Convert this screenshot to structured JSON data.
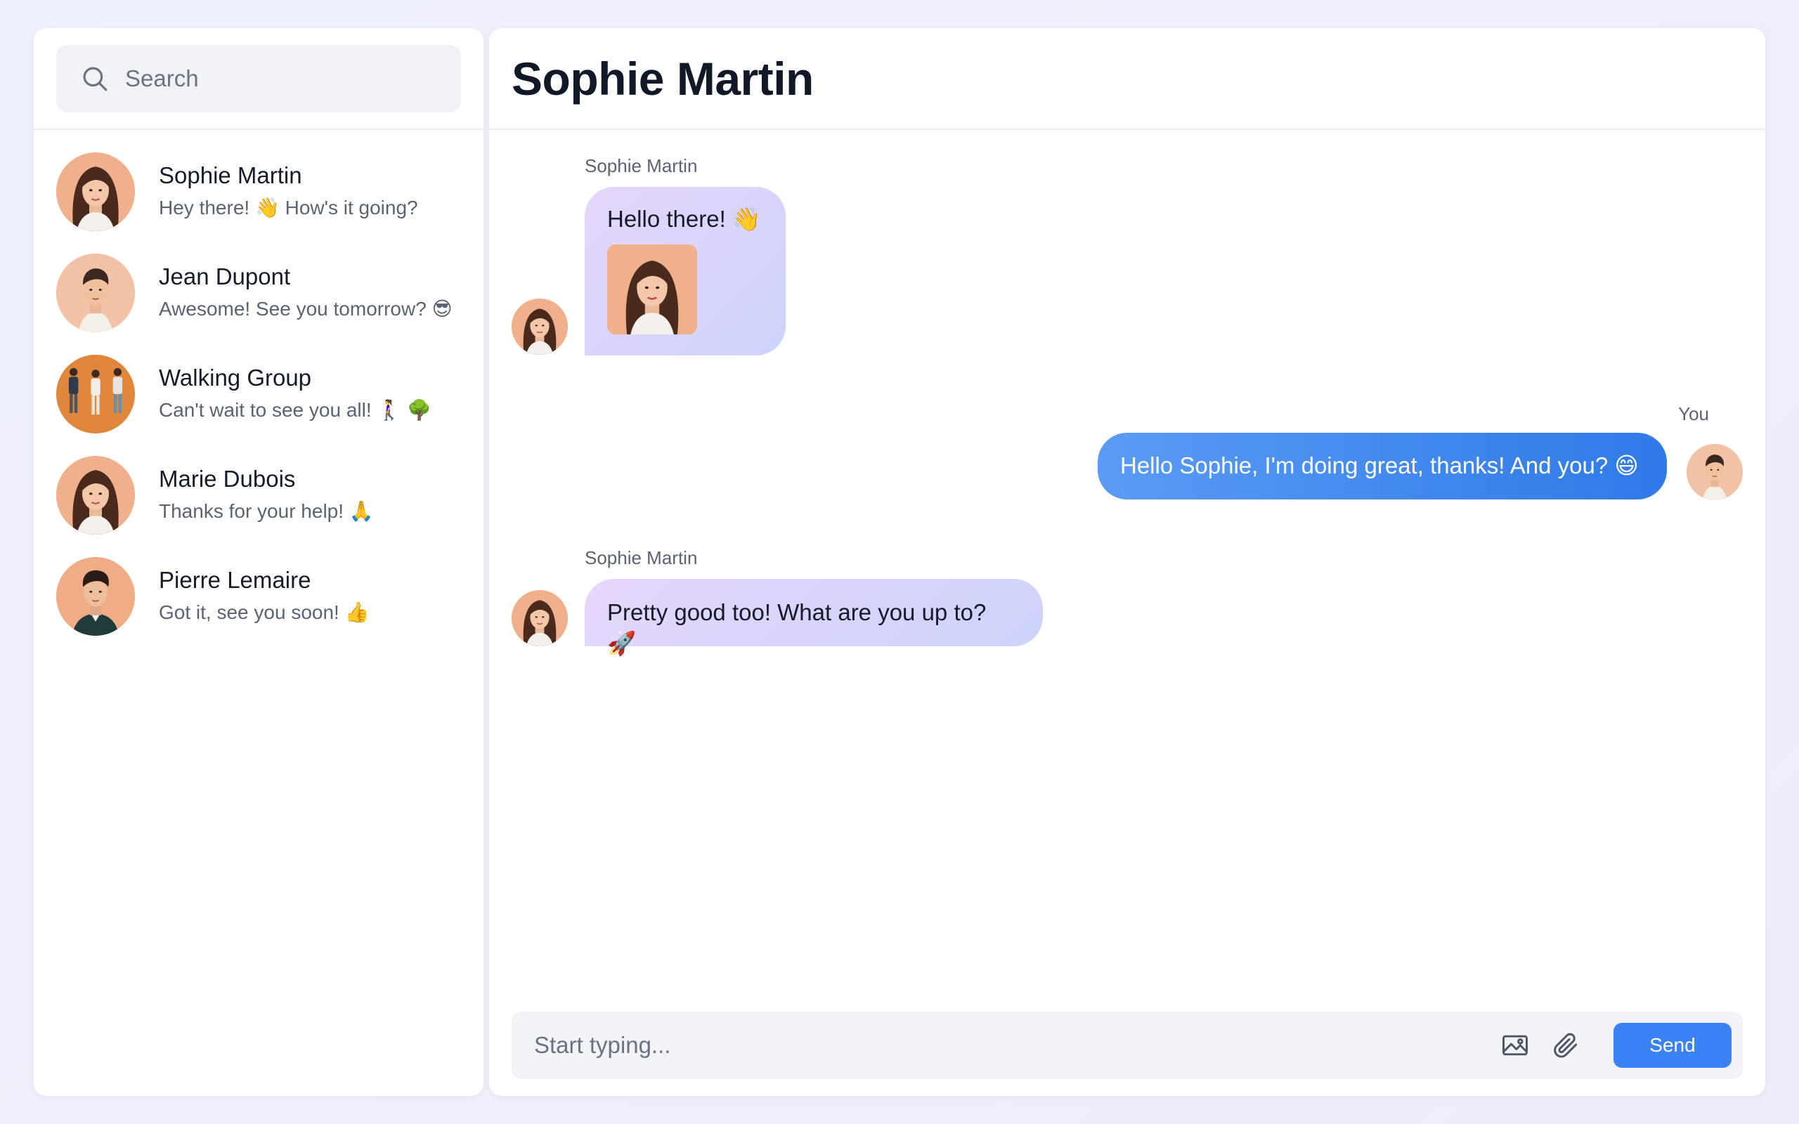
{
  "search": {
    "placeholder": "Search"
  },
  "contacts": [
    {
      "name": "Sophie Martin",
      "preview": "Hey there! 👋 How's it going?",
      "avatar": "woman-long-hair"
    },
    {
      "name": "Jean Dupont",
      "preview": "Awesome! See you tomorrow? 😎",
      "avatar": "man-short-hair"
    },
    {
      "name": "Walking Group",
      "preview": "Can't wait to see you all! 🚶‍♀️ 🌳",
      "avatar": "group-people"
    },
    {
      "name": "Marie Dubois",
      "preview": "Thanks for your help! 🙏",
      "avatar": "woman-wavy-hair"
    },
    {
      "name": "Pierre Lemaire",
      "preview": "Got it, see you soon! 👍",
      "avatar": "man-dark-shirt"
    }
  ],
  "chat": {
    "title": "Sophie Martin",
    "messages": [
      {
        "sender": "Sophie Martin",
        "text": "Hello there! 👋",
        "direction": "incoming",
        "has_image": true
      },
      {
        "sender": "You",
        "text": "Hello Sophie, I'm doing great, thanks! And you? 😄",
        "direction": "outgoing"
      },
      {
        "sender": "Sophie Martin",
        "text": "Pretty good too! What are you up to? 🚀",
        "direction": "incoming"
      }
    ]
  },
  "composer": {
    "placeholder": "Start typing...",
    "image_icon": "image-icon",
    "attach_icon": "paperclip-icon",
    "send_label": "Send"
  },
  "colors": {
    "accent": "#3b82f6",
    "incoming_bubble_start": "#e6d6fb",
    "incoming_bubble_end": "#cdd3fb",
    "outgoing_bubble": "#2f7ae8",
    "avatar_bg": "#f2b89a"
  }
}
